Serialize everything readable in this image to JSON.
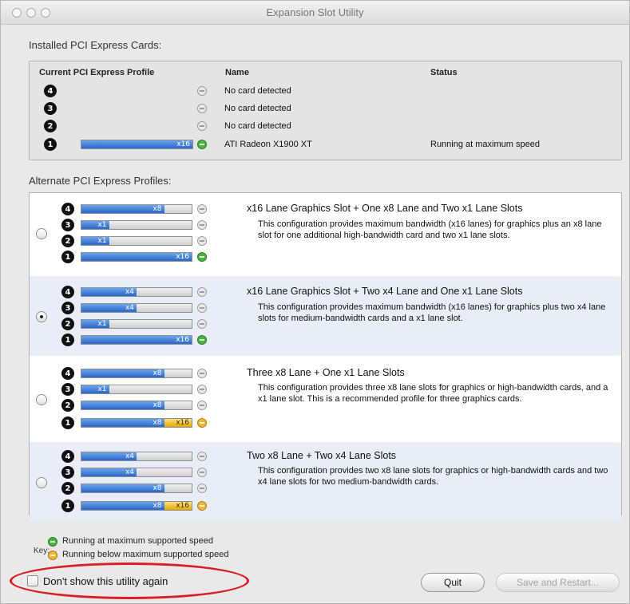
{
  "window": {
    "title": "Expansion Slot Utility"
  },
  "installed": {
    "section_label": "Installed PCI Express Cards:",
    "headers": {
      "profile": "Current PCI Express Profile",
      "name": "Name",
      "status": "Status"
    },
    "rows": [
      {
        "slot": "4",
        "fill": "",
        "name": "No card detected",
        "status": ""
      },
      {
        "slot": "3",
        "fill": "",
        "name": "No card detected",
        "status": ""
      },
      {
        "slot": "2",
        "fill": "",
        "name": "No card detected",
        "status": ""
      },
      {
        "slot": "1",
        "fill": "x16",
        "name": "ATI Radeon X1900 XT",
        "status": "Running at maximum speed"
      }
    ]
  },
  "alternate": {
    "section_label": "Alternate PCI Express Profiles:",
    "profiles": [
      {
        "title": "x16 Lane Graphics Slot + One x8 Lane and Two x1 Lane Slots",
        "desc": "This configuration provides maximum bandwidth (x16 lanes) for graphics plus an x8 lane slot for one additional high-bandwidth card and two x1 lane slots.",
        "selected": false,
        "slots": [
          {
            "slot": "4",
            "label": "x8"
          },
          {
            "slot": "3",
            "label": "x1"
          },
          {
            "slot": "2",
            "label": "x1"
          },
          {
            "slot": "1",
            "label": "x16"
          }
        ]
      },
      {
        "title": "x16 Lane Graphics Slot + Two x4 Lane and One x1 Lane Slots",
        "desc": "This configuration provides maximum bandwidth (x16 lanes) for graphics plus two x4 lane slots for medium-bandwidth cards and a x1 lane slot.",
        "selected": true,
        "slots": [
          {
            "slot": "4",
            "label": "x4"
          },
          {
            "slot": "3",
            "label": "x4"
          },
          {
            "slot": "2",
            "label": "x1"
          },
          {
            "slot": "1",
            "label": "x16"
          }
        ]
      },
      {
        "title": "Three x8 Lane + One x1 Lane Slots",
        "desc": "This configuration provides three x8 lane slots for graphics or high-bandwidth cards, and a x1 lane slot.  This is a recommended profile for three graphics cards.",
        "selected": false,
        "slots": [
          {
            "slot": "4",
            "label": "x8"
          },
          {
            "slot": "3",
            "label": "x1"
          },
          {
            "slot": "2",
            "label": "x8"
          },
          {
            "slot": "1",
            "label": "x8",
            "extra": "x16"
          }
        ]
      },
      {
        "title": "Two x8 Lane + Two x4 Lane Slots",
        "desc": "This configuration provides two x8 lane slots for graphics or high-bandwidth cards and two x4 lane slots for two medium-bandwidth cards.",
        "selected": false,
        "slots": [
          {
            "slot": "4",
            "label": "x4"
          },
          {
            "slot": "3",
            "label": "x4"
          },
          {
            "slot": "2",
            "label": "x8"
          },
          {
            "slot": "1",
            "label": "x8",
            "extra": "x16"
          }
        ]
      }
    ]
  },
  "key": {
    "label": "Key:",
    "green": "Running at maximum supported speed",
    "orange": "Running below maximum supported speed"
  },
  "footer": {
    "checkbox_label": "Don't show this utility again",
    "quit": "Quit",
    "save_restart": "Save and Restart..."
  },
  "colors": {
    "lane_fill": "#2a66c9",
    "reduced_fill": "#e5a900",
    "ok_dot": "#48b63b",
    "slow_dot": "#f3b43a",
    "highlight": "#d81f26"
  }
}
